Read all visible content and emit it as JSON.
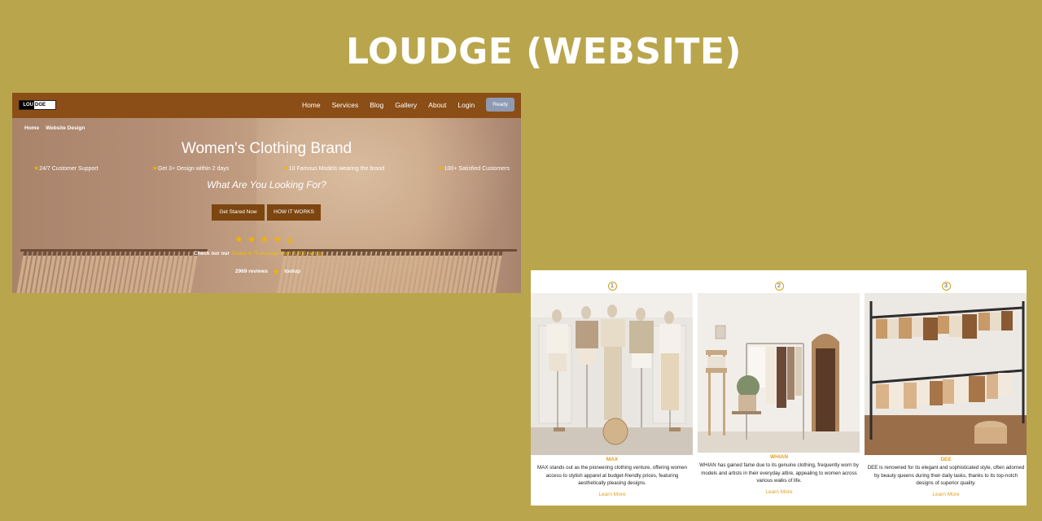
{
  "page_title": "LOUDGE (WEBSITE)",
  "hero": {
    "logo": {
      "dark_part": "LOU",
      "light_part": "DGE"
    },
    "nav": [
      "Home",
      "Services",
      "Blog",
      "Gallery",
      "About",
      "Login"
    ],
    "ready_button": "Ready",
    "breadcrumb": [
      "Home",
      "Website Design"
    ],
    "title": "Women's Clothing Brand",
    "features": [
      "24/7 Customer Support",
      "Get 3+ Design within 2 days",
      "10 Famous Models wearing the brand",
      "100+ Satisfied Customers"
    ],
    "subtitle": "What Are You Looking For?",
    "cta_primary": "Get Stared Now",
    "cta_secondary": "HOW IT WORKS",
    "rating_stars": 4.5,
    "review_prefix": "Check our our",
    "review_highlight": "Toolup 4.75 average from 3,500 ratings",
    "reviews_count": "2969 reviews",
    "reviews_source": "toolup"
  },
  "cards": [
    {
      "number": "1",
      "name": "MAX",
      "description": "MAX stands out as the pioneering clothing venture, offering women access to stylish apparel at budget-friendly prices, featuring aesthetically pleasing designs.",
      "link": "Learn More"
    },
    {
      "number": "2",
      "name": "WHIAN",
      "description": "WHIAN has gained fame due to its genuine clothing, frequently worn by models and artists in their everyday attire, appealing to women across various walks of life.",
      "link": "Learn More"
    },
    {
      "number": "3",
      "name": "DEE",
      "description": "DEE is renowned for its elegant and sophisticated style, often adorned by beauty queens during their daily tasks, thanks to its top-notch designs of superior quality.",
      "link": "Learn More"
    }
  ]
}
